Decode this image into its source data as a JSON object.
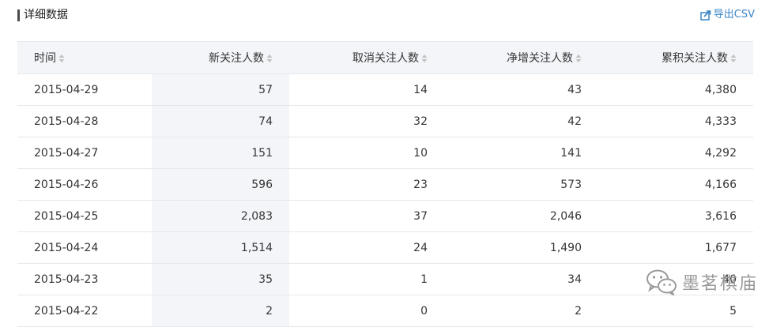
{
  "section": {
    "title": "详细数据",
    "export_label": "导出CSV"
  },
  "table": {
    "headers": [
      "时间",
      "新关注人数",
      "取消关注人数",
      "净增关注人数",
      "累积关注人数"
    ],
    "rows": [
      [
        "2015-04-29",
        "57",
        "14",
        "43",
        "4,380"
      ],
      [
        "2015-04-28",
        "74",
        "32",
        "42",
        "4,333"
      ],
      [
        "2015-04-27",
        "151",
        "10",
        "141",
        "4,292"
      ],
      [
        "2015-04-26",
        "596",
        "23",
        "573",
        "4,166"
      ],
      [
        "2015-04-25",
        "2,083",
        "37",
        "2,046",
        "3,616"
      ],
      [
        "2015-04-24",
        "1,514",
        "24",
        "1,490",
        "1,677"
      ],
      [
        "2015-04-23",
        "35",
        "1",
        "34",
        "40"
      ],
      [
        "2015-04-22",
        "2",
        "0",
        "2",
        "5"
      ]
    ]
  },
  "watermark": {
    "text": "墨茗棋庙",
    "icon": "wechat-icon"
  },
  "colors": {
    "accent": "#3a86c6",
    "header_bg": "#f4f5f9",
    "sorted_column_bg": "#f4f5f9",
    "border": "#e7e7eb"
  }
}
